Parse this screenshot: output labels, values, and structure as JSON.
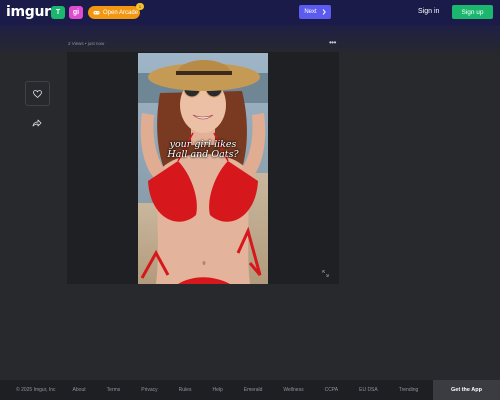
{
  "header": {
    "logo": "imgur",
    "mini_green_glyph": "T",
    "mini_pink_glyph": "gi",
    "arcade_label": "Open Arcade",
    "arcade_badge": "1",
    "next_label": "Next",
    "signin_label": "Sign in",
    "signup_label": "Sign up"
  },
  "post": {
    "meta": "2 Views • just now",
    "caption_line1": "your girl likes",
    "caption_line2": "Hall and Oats?"
  },
  "footer": {
    "links": [
      "© 2025 Imgur, Inc",
      "About",
      "Terms",
      "Privacy",
      "Rules",
      "Help",
      "Emerald",
      "Wellness",
      "CCPA",
      "EU DSA",
      "Trending"
    ],
    "get_app": "Get the App"
  },
  "colors": {
    "header_bg": "#1b1b4a",
    "page_bg": "#27292d",
    "green": "#1bb76e",
    "next_blue": "#5b5bf0",
    "arcade_orange": "#f29711"
  },
  "icons": [
    "heart-icon",
    "share-arrow-icon",
    "more-dots-icon",
    "chevron-right-icon",
    "expand-icon",
    "controller-icon"
  ]
}
